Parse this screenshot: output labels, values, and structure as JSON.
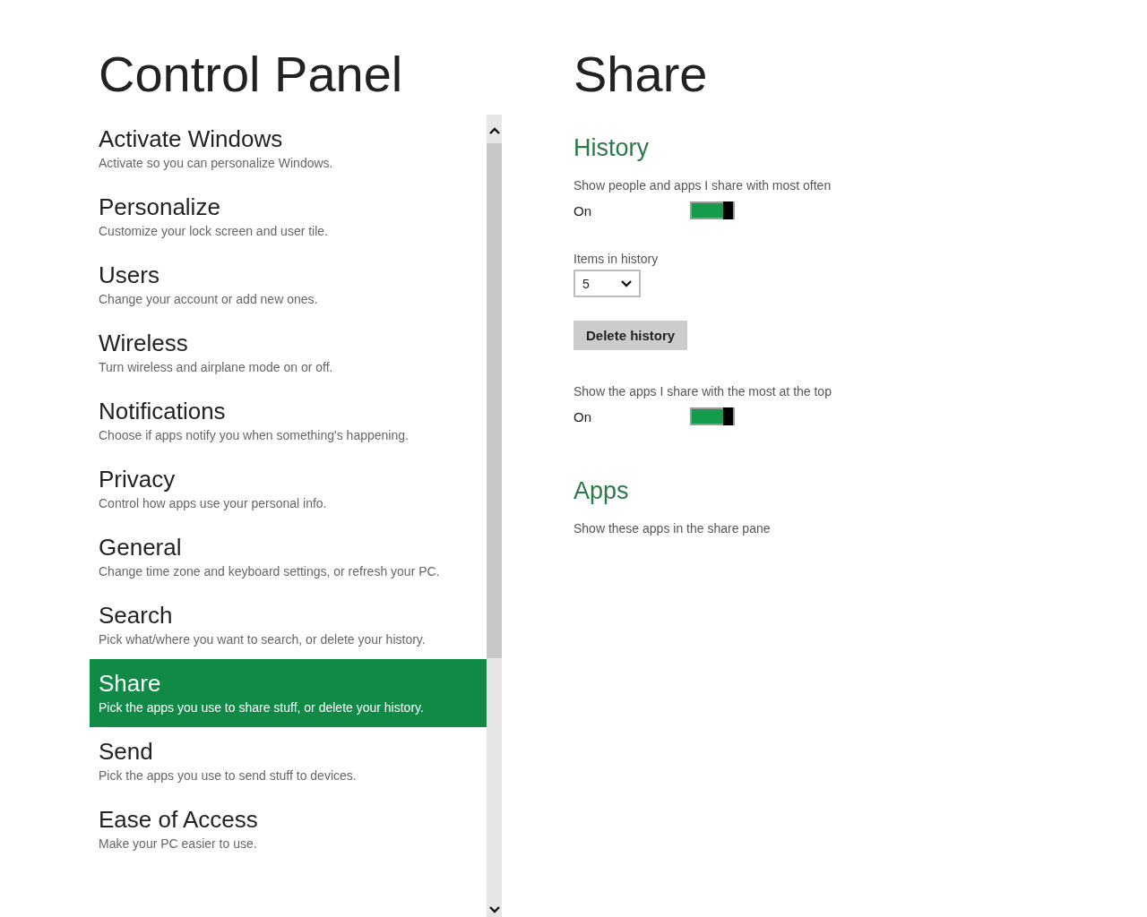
{
  "sidebar": {
    "title": "Control Panel",
    "items": [
      {
        "label": "Activate Windows",
        "description": "Activate so you can personalize Windows.",
        "selected": false
      },
      {
        "label": "Personalize",
        "description": "Customize your lock screen and user tile.",
        "selected": false
      },
      {
        "label": "Users",
        "description": "Change your account or add new ones.",
        "selected": false
      },
      {
        "label": "Wireless",
        "description": "Turn wireless and airplane mode on or off.",
        "selected": false
      },
      {
        "label": "Notifications",
        "description": "Choose if apps notify you when something's happening.",
        "selected": false
      },
      {
        "label": "Privacy",
        "description": "Control how apps use your personal info.",
        "selected": false
      },
      {
        "label": "General",
        "description": "Change time zone and keyboard settings, or refresh your PC.",
        "selected": false
      },
      {
        "label": "Search",
        "description": "Pick what/where you want to search, or delete your history.",
        "selected": false
      },
      {
        "label": "Share",
        "description": "Pick the apps you use to share stuff, or delete your history.",
        "selected": true
      },
      {
        "label": "Send",
        "description": "Pick the apps you use to send stuff to devices.",
        "selected": false
      },
      {
        "label": "Ease of Access",
        "description": "Make your PC easier to use.",
        "selected": false
      }
    ]
  },
  "page": {
    "title": "Share",
    "sections": [
      {
        "heading": "History",
        "controls": [
          {
            "kind": "toggle",
            "label": "Show people and apps I share with most often",
            "state_text": "On",
            "on": true
          },
          {
            "kind": "dropdown",
            "label": "Items in history",
            "value": "5"
          },
          {
            "kind": "button",
            "label": "Delete history"
          },
          {
            "kind": "toggle",
            "label": "Show the apps I share with the most at the top",
            "state_text": "On",
            "on": true
          }
        ]
      },
      {
        "heading": "Apps",
        "controls": [
          {
            "kind": "text",
            "label": "Show these apps in the share pane"
          }
        ]
      }
    ]
  }
}
